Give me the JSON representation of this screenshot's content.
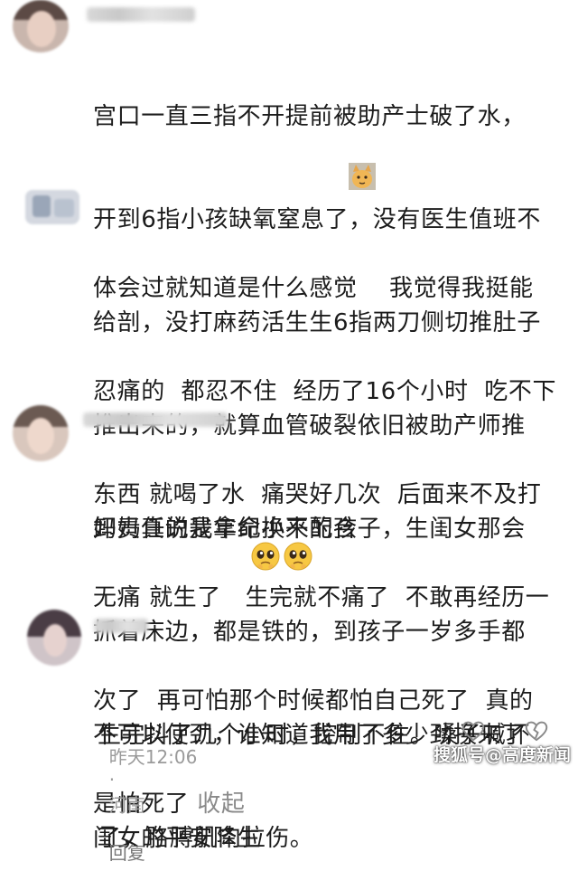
{
  "comments": [
    {
      "lines": [
        "宫口一直三指不开提前被助产士破了水，",
        "开到6指小孩缺氧窒息了，没有医生值班不",
        "给剖，没打麻药活生生6指两刀侧切推肚子",
        "推出来的，就算血管破裂依旧被助产师推",
        "卸责任说我年纪小不配合"
      ],
      "emoji": "cat-face-emoji"
    },
    {
      "lines": [
        "体会过就知道是什么感觉    我觉得我挺能",
        "忍痛的  都忍不住  经历了16个小时  吃不下",
        "东西 就喝了水  痛哭好几次  后面来不及打",
        "无痛 就生了   生完就不痛了  不敢再经历一",
        "次了  再可怕那个时候都怕自己死了  真的",
        "是怕死了 "
      ],
      "collapse_label": "收起"
    },
    {
      "lines": [
        "妈妈真的是拿命换来的孩子，生闺女那会",
        "抓着床边，都是铁的，到孩子一岁多手都",
        "不可以使劲，谁知道我用了多少劲换来了",
        "闺女的平安降生"
      ],
      "emoji": "pleading-face-emoji"
    },
    {
      "lines": [
        "生完抖了几个小时，控制不住。嗓子喊坏",
        "了，胳膊肌肉拉伤。"
      ],
      "time": "昨天12:06",
      "separator": "·",
      "location": "河南",
      "reply_label": "回复"
    }
  ],
  "watermark": "搜狐号@高度新闻"
}
